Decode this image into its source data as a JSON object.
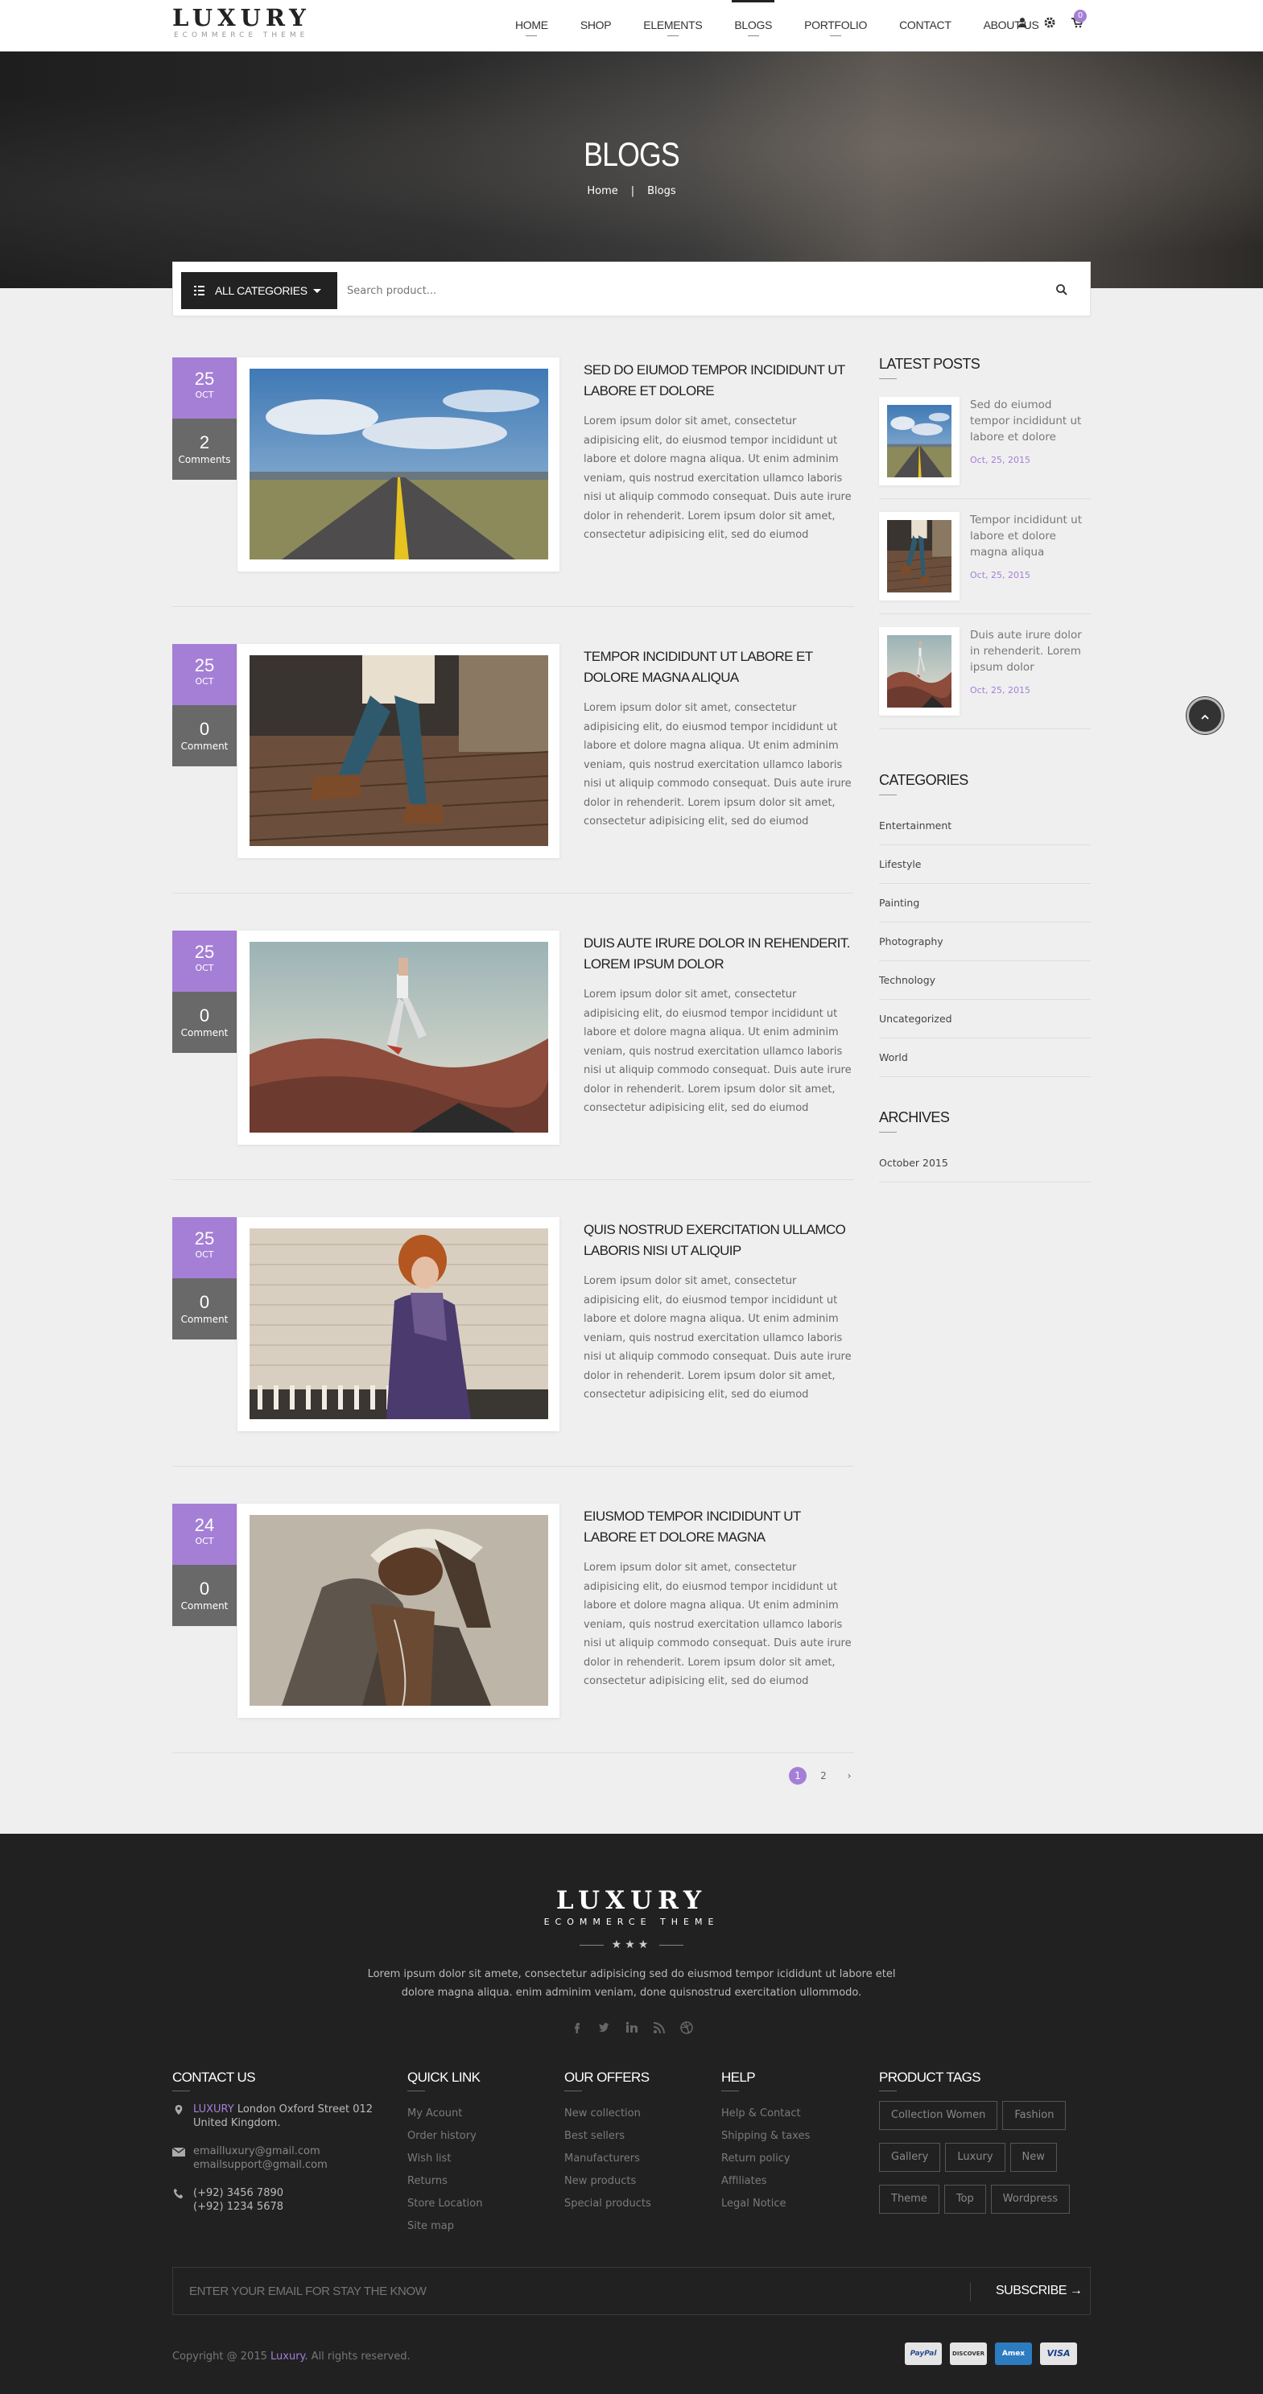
{
  "header": {
    "logo_main": "LUXURY",
    "logo_sub": "ECOMMERCE THEME",
    "nav": [
      {
        "label": "HOME",
        "underline": true
      },
      {
        "label": "SHOP",
        "underline": false
      },
      {
        "label": "ELEMENTS",
        "underline": true
      },
      {
        "label": "BLOGS",
        "underline": true
      },
      {
        "label": "PORTFOLIO",
        "underline": true
      },
      {
        "label": "CONTACT",
        "underline": false
      },
      {
        "label": "ABOUT US",
        "underline": false
      }
    ],
    "cart_count": "0",
    "accent_color": "#a57fd6"
  },
  "banner": {
    "title": "BLOGS",
    "breadcrumb": [
      "Home",
      "Blogs"
    ],
    "separator": "|"
  },
  "search": {
    "category_label": "ALL CATEGORIES",
    "placeholder": "Search product..."
  },
  "posts": [
    {
      "day": "25",
      "month": "OCT",
      "comments": "2",
      "comments_label": "Comments",
      "title": "SED DO EIUMOD TEMPOR INCIDIDUNT UT LABORE ET DOLORE",
      "excerpt": "Lorem ipsum dolor sit amet, consectetur adipisicing elit, do eiusmod tempor incididunt ut labore et dolore magna aliqua. Ut enim adminim veniam, quis nostrud exercitation ullamco laboris nisi ut aliquip commodo consequat. Duis aute irure dolor in rehenderit. Lorem ipsum dolor sit amet, consectetur adipisicing elit, sed do eiumod",
      "image": "road"
    },
    {
      "day": "25",
      "month": "OCT",
      "comments": "0",
      "comments_label": "Comment",
      "title": "TEMPOR INCIDIDUNT UT LABORE ET DOLORE MAGNA ALIQUA",
      "excerpt": "Lorem ipsum dolor sit amet, consectetur adipisicing elit, do eiusmod tempor incididunt ut labore et dolore magna aliqua. Ut enim adminim veniam, quis nostrud exercitation ullamco laboris nisi ut aliquip commodo consequat. Duis aute irure dolor in rehenderit. Lorem ipsum dolor sit amet, consectetur adipisicing elit, sed do eiumod",
      "image": "boots"
    },
    {
      "day": "25",
      "month": "OCT",
      "comments": "0",
      "comments_label": "Comment",
      "title": "DUIS AUTE IRURE DOLOR IN REHENDERIT. LOREM IPSUM DOLOR",
      "excerpt": "Lorem ipsum dolor sit amet, consectetur adipisicing elit, do eiusmod tempor incididunt ut labore et dolore magna aliqua. Ut enim adminim veniam, quis nostrud exercitation ullamco laboris nisi ut aliquip commodo consequat. Duis aute irure dolor in rehenderit. Lorem ipsum dolor sit amet, consectetur adipisicing elit, sed do eiumod",
      "image": "dancer"
    },
    {
      "day": "25",
      "month": "OCT",
      "comments": "0",
      "comments_label": "Comment",
      "title": "QUIS NOSTRUD EXERCITATION ULLAMCO LABORIS NISI UT ALIQUIP",
      "excerpt": "Lorem ipsum dolor sit amet, consectetur adipisicing elit, do eiusmod tempor incididunt ut labore et dolore magna aliqua. Ut enim adminim veniam, quis nostrud exercitation ullamco laboris nisi ut aliquip commodo consequat. Duis aute irure dolor in rehenderit. Lorem ipsum dolor sit amet, consectetur adipisicing elit, sed do eiumod",
      "image": "woman"
    },
    {
      "day": "24",
      "month": "OCT",
      "comments": "0",
      "comments_label": "Comment",
      "title": "EIUSMOD TEMPOR INCIDIDUNT UT LABORE ET DOLORE MAGNA",
      "excerpt": "Lorem ipsum dolor sit amet, consectetur adipisicing elit, do eiusmod tempor incididunt ut labore et dolore magna aliqua. Ut enim adminim veniam, quis nostrud exercitation ullamco laboris nisi ut aliquip commodo consequat. Duis aute irure dolor in rehenderit. Lorem ipsum dolor sit amet, consectetur adipisicing elit, sed do eiumod",
      "image": "man"
    }
  ],
  "pagination": {
    "pages": [
      "1",
      "2"
    ],
    "current": "1",
    "next": "›"
  },
  "sidebar": {
    "latest_title": "LATEST POSTS",
    "latest": [
      {
        "title": "Sed do eiumod tempor incididunt ut labore et dolore",
        "date": "Oct, 25, 2015",
        "image": "road"
      },
      {
        "title": "Tempor incididunt ut labore et dolore magna aliqua",
        "date": "Oct, 25, 2015",
        "image": "boots"
      },
      {
        "title": "Duis aute irure dolor in rehenderit. Lorem ipsum dolor",
        "date": "Oct, 25, 2015",
        "image": "dancer"
      }
    ],
    "categories_title": "CATEGORIES",
    "categories": [
      "Entertainment",
      "Lifestyle",
      "Painting",
      "Photography",
      "Technology",
      "Uncategorized",
      "World"
    ],
    "archives_title": "ARCHIVES",
    "archives": [
      "October 2015"
    ]
  },
  "footer": {
    "logo_main": "LUXURY",
    "logo_sub": "ECOMMERCE THEME",
    "stars": "★★★",
    "description": "Lorem ipsum dolor sit amete, consectetur adipisicing sed do eiusmod tempor icididunt ut labore etel dolore magna aliqua. enim adminim veniam, done quisnostrud exercitation ullommodo.",
    "social_icons": [
      "facebook-icon",
      "twitter-icon",
      "linkedin-icon",
      "rss-icon",
      "dribbble-icon"
    ],
    "contact": {
      "title": "CONTACT US",
      "address_brand": "LUXURY",
      "address": "London Oxford Street 012 United Kingdom.",
      "emails": [
        "emailluxury@gmail.com",
        "emailsupport@gmail.com"
      ],
      "phones": [
        "(+92) 3456 7890",
        "(+92) 1234 5678"
      ]
    },
    "quick_link": {
      "title": "QUICK LINK",
      "items": [
        "My Acount",
        "Order history",
        "Wish list",
        "Returns",
        "Store Location",
        "Site map"
      ]
    },
    "offers": {
      "title": "OUR OFFERS",
      "items": [
        "New collection",
        "Best sellers",
        "Manufacturers",
        "New products",
        "Special products"
      ]
    },
    "help": {
      "title": "HELP",
      "items": [
        "Help & Contact",
        "Shipping & taxes",
        "Return policy",
        "Affiliates",
        "Legal Notice"
      ]
    },
    "tags": {
      "title": "PRODUCT TAGS",
      "rows": [
        [
          "Collection Women",
          "Fashion"
        ],
        [
          "Gallery",
          "Luxury",
          "New"
        ],
        [
          "Theme",
          "Top",
          "Wordpress"
        ]
      ]
    },
    "subscribe_placeholder": "ENTER YOUR EMAIL FOR STAY THE KNOW",
    "subscribe_label": "SUBSCRIBE →",
    "copyright_pre": "Copyright @ 2015",
    "copyright_brand": "Luxury.",
    "copyright_post": "All rights reserved.",
    "payments": [
      "PayPal",
      "DISCOVER",
      "Amex",
      "VISA"
    ]
  }
}
